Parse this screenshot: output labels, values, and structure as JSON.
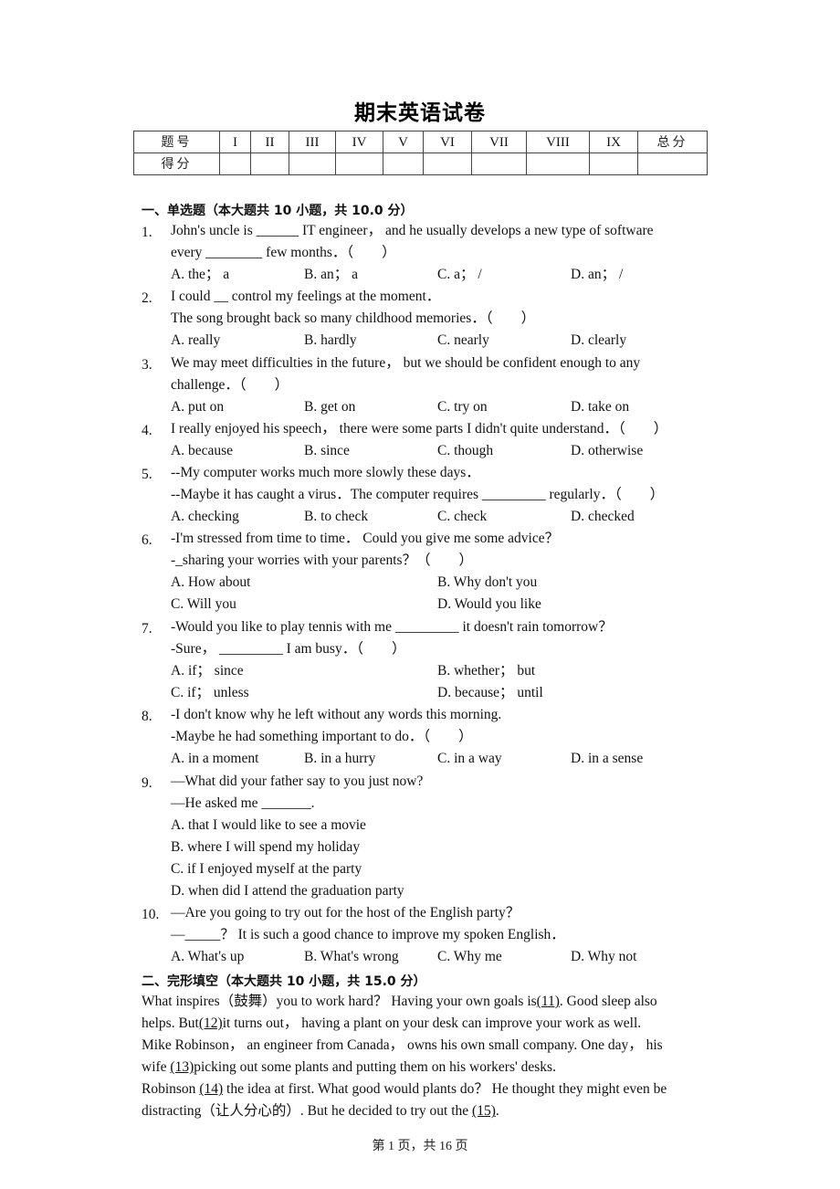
{
  "document": {
    "title": "期末英语试卷",
    "score_table": {
      "header_label": "题号",
      "columns": [
        "I",
        "II",
        "III",
        "IV",
        "V",
        "VI",
        "VII",
        "VIII",
        "IX"
      ],
      "total_label": "总分",
      "score_label": "得分",
      "scores": [
        "",
        "",
        "",
        "",
        "",
        "",
        "",
        "",
        "",
        ""
      ]
    },
    "section1": {
      "heading": "一、单选题（本大题共 10 小题，共 10.0 分）",
      "questions": [
        {
          "num": "1.",
          "lines": [
            "John's uncle is ______ IT engineer，  and he usually develops a new type of software",
            "every ________ few months．（　　）"
          ],
          "options": [
            "A. the；  a",
            "B. an；  a",
            "C. a；  /",
            "D. an；  /"
          ]
        },
        {
          "num": "2.",
          "lines": [
            "I could __ control my feelings at the moment．",
            "The song brought back so many childhood memories．（　　）"
          ],
          "options": [
            "A. really",
            "B. hardly",
            "C. nearly",
            "D. clearly"
          ]
        },
        {
          "num": "3.",
          "lines": [
            "We may meet difficulties in the future，  but we should be confident enough to any",
            "challenge．（　　）"
          ],
          "options": [
            "A. put on",
            "B. get on",
            "C. try on",
            "D. take on"
          ]
        },
        {
          "num": "4.",
          "lines": [
            "I really enjoyed his speech，  there were some parts I didn't quite understand．（　　）"
          ],
          "options": [
            "A. because",
            "B. since",
            "C. though",
            "D. otherwise"
          ]
        },
        {
          "num": "5.",
          "lines": [
            "--My computer works much more slowly these days．",
            "--Maybe it has caught a virus．The computer requires _________ regularly．（　　）"
          ],
          "options": [
            "A. checking",
            "B. to check",
            "C. check",
            "D. checked"
          ]
        },
        {
          "num": "6.",
          "lines": [
            "-I'm stressed from time to time．  Could you give me some advice？",
            "-_sharing your worries with your parents？（　　）"
          ],
          "options": [
            "A. How about",
            "B. Why don't you",
            "C. Will you",
            "D. Would you like"
          ]
        },
        {
          "num": "7.",
          "lines": [
            "-Would you like to play tennis with me _________ it doesn't rain tomorrow？",
            "-Sure，  _________ I am busy．（　　）"
          ],
          "options": [
            "A. if；  since",
            "B. whether；  but",
            "C. if；  unless",
            "D. because；  until"
          ]
        },
        {
          "num": "8.",
          "lines": [
            "-I don't know why he left without any words this morning.",
            "-Maybe he had something important to do．（　　）"
          ],
          "options": [
            "A. in a moment",
            "B. in a hurry",
            "C. in a way",
            "D. in a sense"
          ]
        },
        {
          "num": "9.",
          "lines": [
            "—What did your father say to you just now?",
            "—He asked me _______."
          ],
          "options": [
            "A. that I would like to see a movie",
            "B. where I will spend my holiday",
            "C. if I enjoyed myself at the party",
            "D. when did I attend the graduation party"
          ]
        },
        {
          "num": "10.",
          "lines": [
            "—Are you going to try out for the host of the English party？",
            "—_____？ It is such a good chance to improve my spoken English．"
          ],
          "options": [
            "A. What's up",
            "B. What's wrong",
            "C. Why me",
            "D. Why not"
          ]
        }
      ]
    },
    "section2": {
      "heading": "二、完形填空（本大题共 10 小题，共 15.0 分）",
      "passage": [
        [
          {
            "t": "What inspires（鼓舞）you to work hard？  Having your own goals is"
          },
          {
            "t": "(11)",
            "u": true
          },
          {
            "t": ".   Good sleep also"
          }
        ],
        [
          {
            "t": "helps.   But"
          },
          {
            "t": "(12)",
            "u": true
          },
          {
            "t": "it turns out，  having a plant on your desk can improve your work as well."
          }
        ],
        [
          {
            "t": "Mike Robinson，  an engineer from Canada，  owns his own small company.   One day，  his"
          }
        ],
        [
          {
            "t": "wife "
          },
          {
            "t": "(13)",
            "u": true
          },
          {
            "t": "picking out some plants and putting them on his workers' desks."
          }
        ],
        [
          {
            "t": "Robinson "
          },
          {
            "t": "(14)",
            "u": true
          },
          {
            "t": " the idea at first.  What good would plants do？ He thought they might even be"
          }
        ],
        [
          {
            "t": "distracting（让人分心的）.   But he decided to try out the "
          },
          {
            "t": "(15)",
            "u": true
          },
          {
            "t": "."
          }
        ]
      ]
    },
    "footer": "第 1 页，共 16 页"
  }
}
